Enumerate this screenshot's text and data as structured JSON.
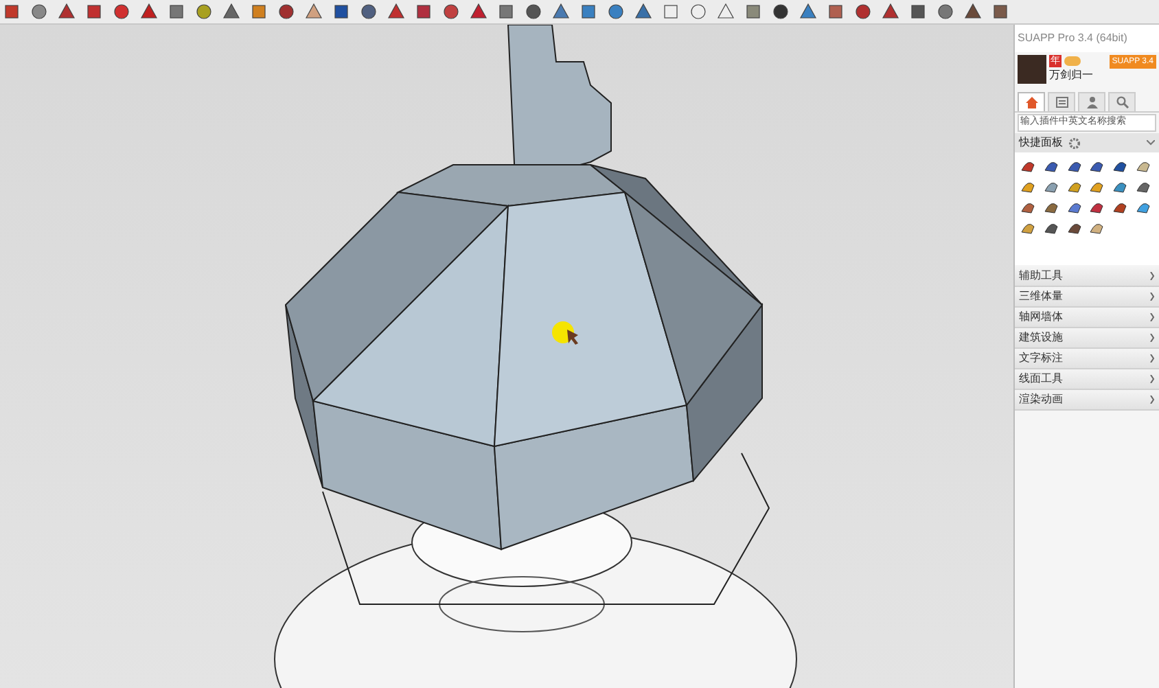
{
  "panel": {
    "title": "SUAPP Pro 3.4 (64bit)",
    "user_name": "万剑归一",
    "year_badge": "年",
    "upgrade_button": "SUAPP 3.4"
  },
  "tabs": [
    {
      "kind": "home",
      "selected": true
    },
    {
      "kind": "list",
      "selected": false
    },
    {
      "kind": "user",
      "selected": false
    },
    {
      "kind": "search",
      "selected": false
    }
  ],
  "search": {
    "placeholder": "输入插件中英文名称搜索"
  },
  "quick_panel": {
    "title": "快捷面板"
  },
  "categories": [
    {
      "label": "辅助工具",
      "expanded": false
    },
    {
      "label": "三维体量",
      "expanded": false
    },
    {
      "label": "轴网墙体",
      "expanded": false
    },
    {
      "label": "建筑设施",
      "expanded": false
    },
    {
      "label": "文字标注",
      "expanded": false
    },
    {
      "label": "线面工具",
      "expanded": false
    },
    {
      "label": "渲染动画",
      "expanded": false
    }
  ]
}
